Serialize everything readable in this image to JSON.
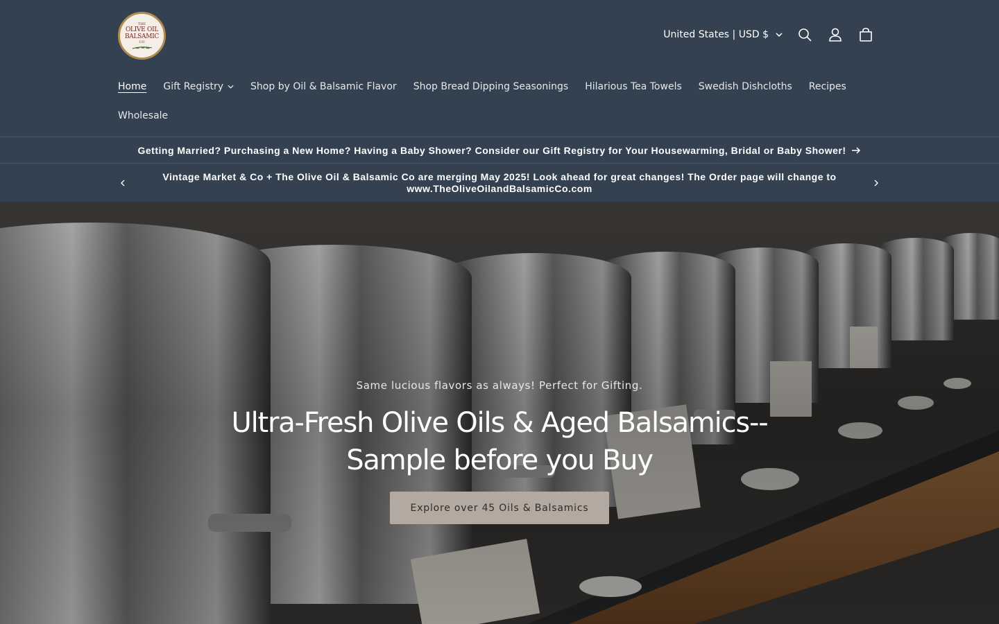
{
  "logo": {
    "line1": "THE",
    "line2": "OLIVE OIL",
    "line3": "BALSAMIC",
    "line4": "CO"
  },
  "header": {
    "currency": "United States | USD $",
    "icons": [
      "chevron-down-icon",
      "search-icon",
      "account-icon",
      "cart-icon"
    ]
  },
  "nav": {
    "items": [
      {
        "label": "Home",
        "active": true
      },
      {
        "label": "Gift Registry",
        "has_dropdown": true
      },
      {
        "label": "Shop by Oil & Balsamic Flavor"
      },
      {
        "label": "Shop Bread Dipping Seasonings"
      },
      {
        "label": "Hilarious Tea Towels"
      },
      {
        "label": "Swedish Dishcloths"
      },
      {
        "label": "Recipes"
      },
      {
        "label": "Wholesale"
      }
    ]
  },
  "announcement": {
    "text": "Getting Married? Purchasing a New Home? Having a Baby Shower? Consider our Gift Registry for Your Housewarming, Bridal or Baby Shower!"
  },
  "slideshow_bar": {
    "text": "Vintage Market & Co + The Olive Oil & Balsamic Co are merging May 2025! Look ahead for great changes! The Order page will change to www.TheOliveOilandBalsamicCo.com"
  },
  "hero": {
    "subtitle": "Same lucious flavors as always! Perfect for Gifting.",
    "title": "Ultra-Fresh Olive Oils & Aged Balsamics--Sample before you Buy",
    "button": "Explore over 45 Oils & Balsamics"
  },
  "colors": {
    "header_bg": "#334150",
    "button_bg": "#b3a9a0",
    "text": "#ffffff"
  }
}
